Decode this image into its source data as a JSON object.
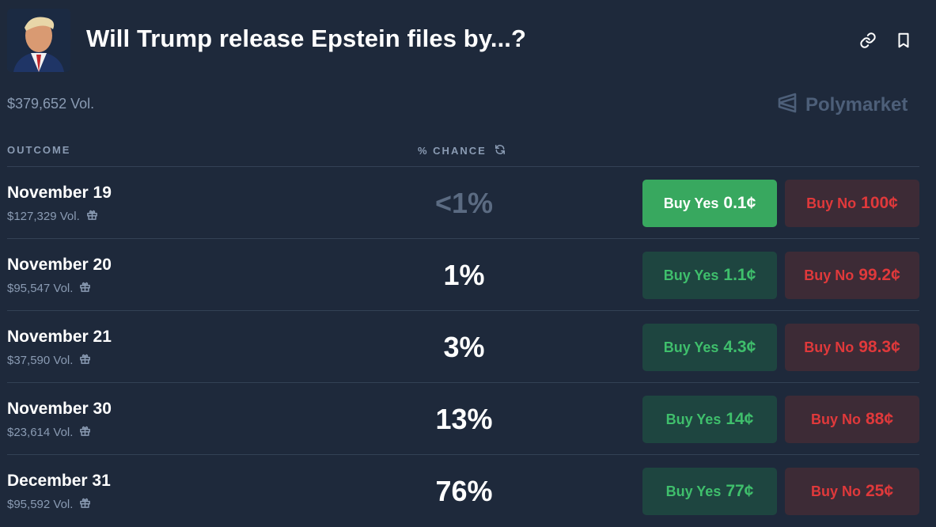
{
  "header": {
    "title": "Will Trump release Epstein files by...?",
    "avatar_icon": "portrait-image",
    "link_icon": "link-icon",
    "bookmark_icon": "bookmark-icon"
  },
  "summary": {
    "total_volume": "$379,652 Vol.",
    "brand": "Polymarket"
  },
  "columns": {
    "outcome": "OUTCOME",
    "chance": "% CHANCE"
  },
  "colors": {
    "background": "#1e293b",
    "yes_active": "#38a85f",
    "yes": "#3fbf6c",
    "no": "#e0393b"
  },
  "outcomes": [
    {
      "name": "November 19",
      "volume": "$127,329 Vol.",
      "chance": "<1%",
      "yes_label": "Buy Yes",
      "yes_price": "0.1¢",
      "no_label": "Buy No",
      "no_price": "100¢"
    },
    {
      "name": "November 20",
      "volume": "$95,547 Vol.",
      "chance": "1%",
      "yes_label": "Buy Yes",
      "yes_price": "1.1¢",
      "no_label": "Buy No",
      "no_price": "99.2¢"
    },
    {
      "name": "November 21",
      "volume": "$37,590 Vol.",
      "chance": "3%",
      "yes_label": "Buy Yes",
      "yes_price": "4.3¢",
      "no_label": "Buy No",
      "no_price": "98.3¢"
    },
    {
      "name": "November 30",
      "volume": "$23,614 Vol.",
      "chance": "13%",
      "yes_label": "Buy Yes",
      "yes_price": "14¢",
      "no_label": "Buy No",
      "no_price": "88¢"
    },
    {
      "name": "December 31",
      "volume": "$95,592 Vol.",
      "chance": "76%",
      "yes_label": "Buy Yes",
      "yes_price": "77¢",
      "no_label": "Buy No",
      "no_price": "25¢"
    }
  ]
}
